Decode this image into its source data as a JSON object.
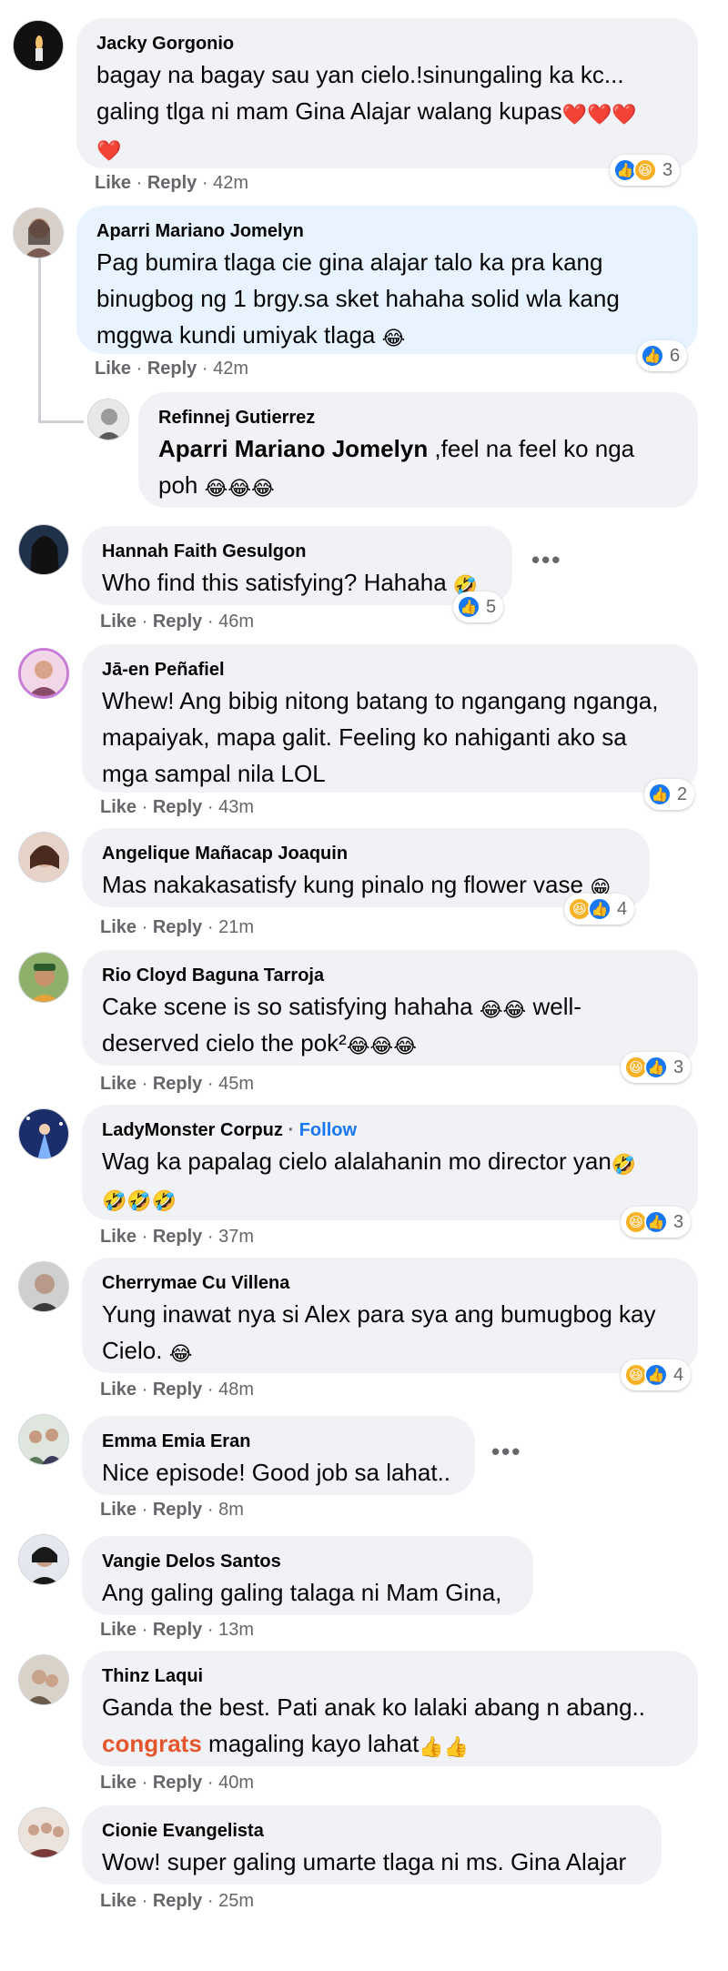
{
  "comments": [
    {
      "name": "Jacky Gorgonio",
      "text": "bagay na bagay sau yan cielo.!sinungaling ka kc... galing tlga ni mam Gina Alajar walang kupas",
      "text_emojis": "❤️❤️❤️",
      "text_emojis_2": "❤️",
      "like": "Like",
      "reply": "Reply",
      "time": "42m",
      "reaction_count": "3"
    },
    {
      "name": "Aparri Mariano Jomelyn",
      "text": "Pag bumira tlaga cie gina alajar talo ka pra kang binugbog ng 1 brgy.sa sket hahaha solid wla kang mggwa kundi umiyak tlaga",
      "text_emojis": "😂",
      "like": "Like",
      "reply": "Reply",
      "time": "42m",
      "reaction_count": "6"
    },
    {
      "name": "Refinnej Gutierrez",
      "mention": "Aparri Mariano Jomelyn",
      "text": " ,feel na feel ko nga poh",
      "text_emojis": "😂😂😂"
    },
    {
      "name": "Hannah Faith Gesulgon",
      "text": "Who find this satisfying? Hahaha",
      "text_emojis": "🤣",
      "like": "Like",
      "reply": "Reply",
      "time": "46m",
      "reaction_count": "5"
    },
    {
      "name": "Jā-en Peñafiel",
      "text": "Whew! Ang bibig nitong batang to ngangang nganga, mapaiyak, mapa galit. Feeling ko nahiganti ako sa mga sampal nila LOL",
      "like": "Like",
      "reply": "Reply",
      "time": "43m",
      "reaction_count": "2"
    },
    {
      "name": "Angelique Mañacap Joaquin",
      "text": "Mas nakakasatisfy kung pinalo ng flower vase",
      "text_emojis": "😁",
      "like": "Like",
      "reply": "Reply",
      "time": "21m",
      "reaction_count": "4"
    },
    {
      "name": "Rio Cloyd Baguna Tarroja",
      "text": "Cake scene is so satisfying hahaha",
      "text_emojis": "😂😂",
      "text_2": " well-deserved cielo the pok²",
      "text_emojis_2": "😂😂😂",
      "like": "Like",
      "reply": "Reply",
      "time": "45m",
      "reaction_count": "3"
    },
    {
      "name": "LadyMonster Corpuz",
      "follow": "Follow",
      "text": "Wag ka papalag cielo alalahanin mo director yan",
      "text_emojis": "🤣",
      "text_emojis_2": "🤣🤣🤣",
      "like": "Like",
      "reply": "Reply",
      "time": "37m",
      "reaction_count": "3"
    },
    {
      "name": "Cherrymae Cu Villena",
      "text": "Yung inawat nya si Alex para sya ang bumugbog kay Cielo.",
      "text_emojis": "😂",
      "like": "Like",
      "reply": "Reply",
      "time": "48m",
      "reaction_count": "4"
    },
    {
      "name": "Emma Emia Eran",
      "text": "Nice episode! Good job sa lahat..",
      "like": "Like",
      "reply": "Reply",
      "time": "8m"
    },
    {
      "name": "Vangie Delos Santos",
      "text": "Ang galing galing talaga ni Mam Gina,",
      "like": "Like",
      "reply": "Reply",
      "time": "13m"
    },
    {
      "name": "Thinz Laqui",
      "text": "Ganda the best. Pati anak ko lalaki abang n abang..",
      "highlight_word": "congrats",
      "text_2": " magaling kayo lahat",
      "text_emojis_2": "👍👍",
      "like": "Like",
      "reply": "Reply",
      "time": "40m"
    },
    {
      "name": "Cionie Evangelista",
      "text": "Wow! super galing umarte tlaga ni ms. Gina Alajar",
      "like": "Like",
      "reply": "Reply",
      "time": "25m"
    }
  ],
  "separator": "·",
  "more_label": "•••",
  "colors": {
    "bubble": "#f0f2f5",
    "bubble_highlight": "#e7f3ff",
    "meta_text": "#65676b",
    "like_icon": "#1877f2",
    "haha_icon": "#f7b125",
    "follow": "#1877f2"
  },
  "icons": {
    "like": "thumbs-up-icon",
    "haha": "laughing-face-icon",
    "more": "more-options-icon"
  }
}
